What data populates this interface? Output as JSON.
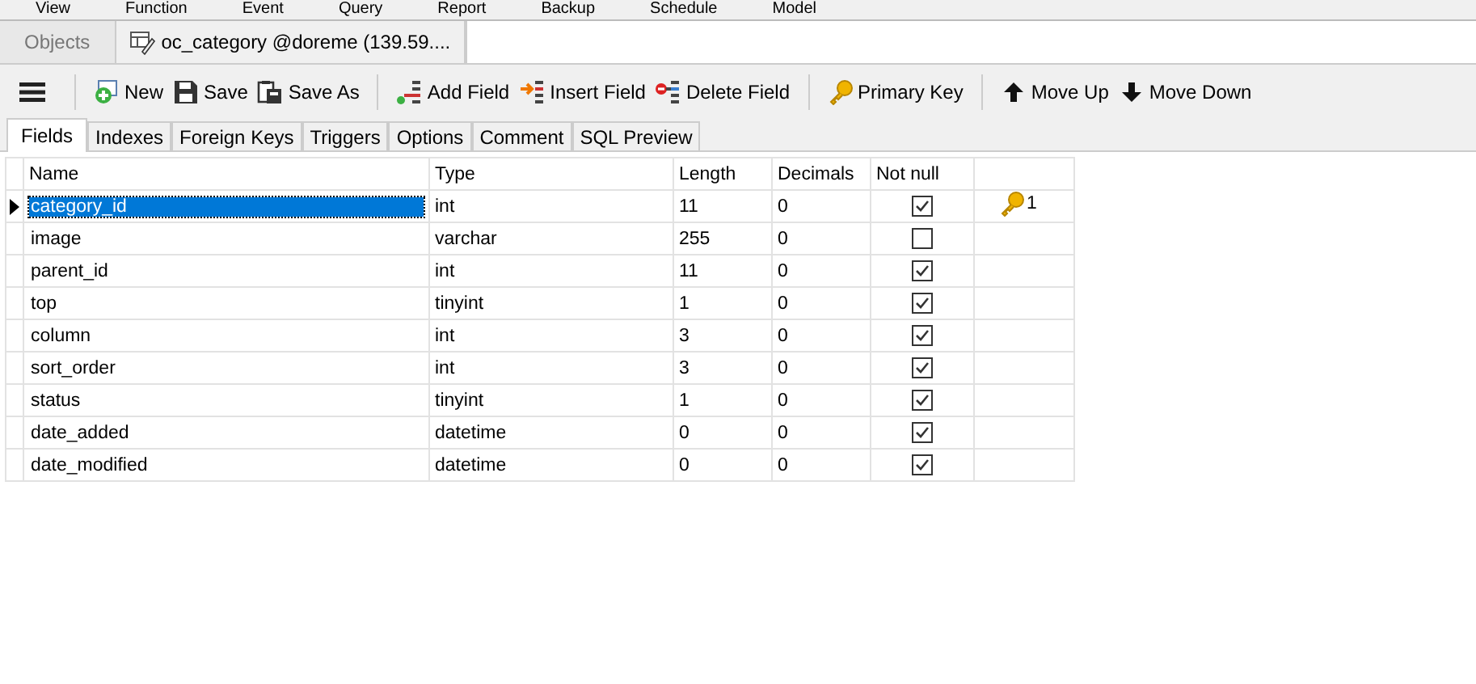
{
  "menu": [
    "View",
    "Function",
    "Event",
    "Query",
    "Report",
    "Backup",
    "Schedule",
    "Model"
  ],
  "doc_tabs": [
    {
      "label": "Objects",
      "selected": false,
      "kind": "plain"
    },
    {
      "label": "oc_category @doreme (139.59....",
      "selected": true,
      "kind": "table"
    }
  ],
  "toolbar_groups": [
    [
      "New",
      "Save",
      "Save As"
    ],
    [
      "Add Field",
      "Insert Field",
      "Delete Field"
    ],
    [
      "Primary Key"
    ],
    [
      "Move Up",
      "Move Down"
    ]
  ],
  "tabs": [
    {
      "label": "Fields",
      "selected": true
    },
    {
      "label": "Indexes",
      "selected": false
    },
    {
      "label": "Foreign Keys",
      "selected": false
    },
    {
      "label": "Triggers",
      "selected": false
    },
    {
      "label": "Options",
      "selected": false
    },
    {
      "label": "Comment",
      "selected": false
    },
    {
      "label": "SQL Preview",
      "selected": false
    }
  ],
  "table": {
    "columns": [
      "Name",
      "Type",
      "Length",
      "Decimals",
      "Not null"
    ],
    "rows": [
      {
        "name": "category_id",
        "type": "int",
        "length": "11",
        "decimals": "0",
        "not_null": true,
        "primary_key": true,
        "key_order": "1",
        "selected": true
      },
      {
        "name": "image",
        "type": "varchar",
        "length": "255",
        "decimals": "0",
        "not_null": false,
        "primary_key": false,
        "selected": false
      },
      {
        "name": "parent_id",
        "type": "int",
        "length": "11",
        "decimals": "0",
        "not_null": true,
        "primary_key": false,
        "selected": false
      },
      {
        "name": "top",
        "type": "tinyint",
        "length": "1",
        "decimals": "0",
        "not_null": true,
        "primary_key": false,
        "selected": false
      },
      {
        "name": "column",
        "type": "int",
        "length": "3",
        "decimals": "0",
        "not_null": true,
        "primary_key": false,
        "selected": false
      },
      {
        "name": "sort_order",
        "type": "int",
        "length": "3",
        "decimals": "0",
        "not_null": true,
        "primary_key": false,
        "selected": false
      },
      {
        "name": "status",
        "type": "tinyint",
        "length": "1",
        "decimals": "0",
        "not_null": true,
        "primary_key": false,
        "selected": false
      },
      {
        "name": "date_added",
        "type": "datetime",
        "length": "0",
        "decimals": "0",
        "not_null": true,
        "primary_key": false,
        "selected": false
      },
      {
        "name": "date_modified",
        "type": "datetime",
        "length": "0",
        "decimals": "0",
        "not_null": true,
        "primary_key": false,
        "selected": false
      }
    ]
  }
}
